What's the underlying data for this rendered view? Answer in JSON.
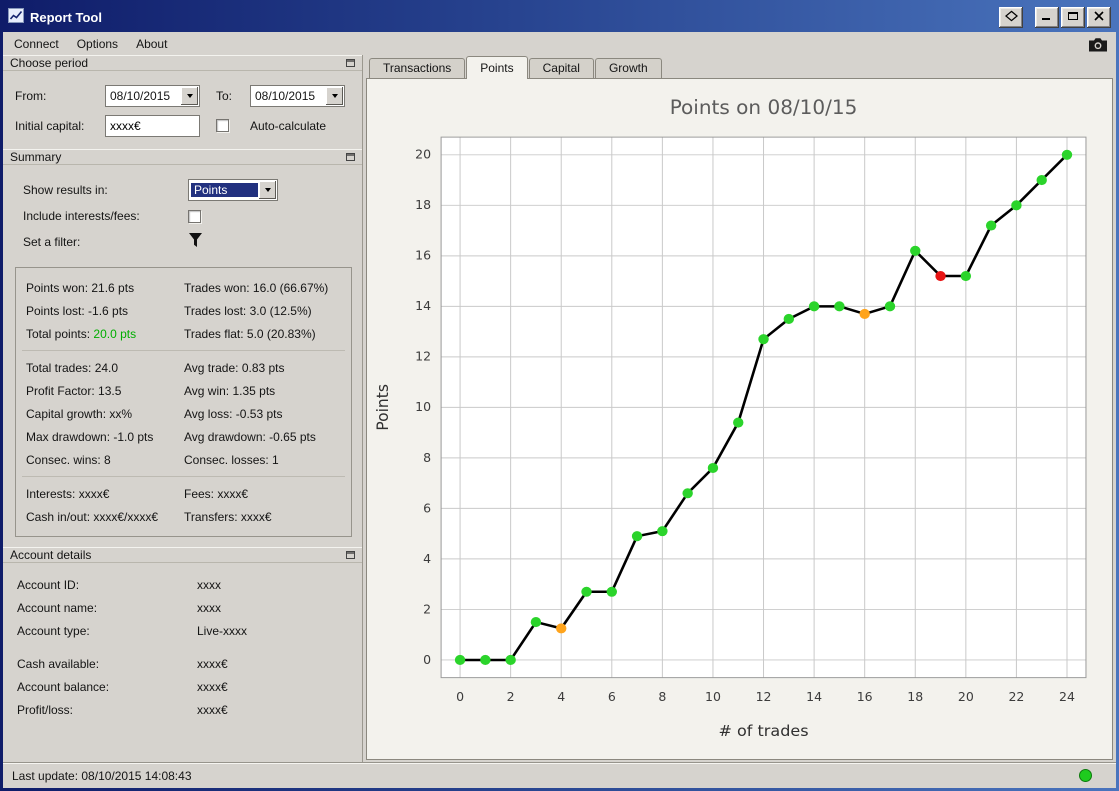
{
  "window": {
    "title": "Report Tool"
  },
  "menu": {
    "items": [
      "Connect",
      "Options",
      "About"
    ]
  },
  "choose_period": {
    "title": "Choose period",
    "from_label": "From:",
    "from_value": "08/10/2015",
    "to_label": "To:",
    "to_value": "08/10/2015",
    "initial_capital_label": "Initial capital:",
    "initial_capital_value": "xxxx€",
    "auto_calculate_label": "Auto-calculate"
  },
  "summary": {
    "title": "Summary",
    "show_results_label": "Show results in:",
    "show_results_value": "Points",
    "include_interests_label": "Include interests/fees:",
    "filter_label": "Set a filter:",
    "stats": {
      "points_won": "Points won: 21.6 pts",
      "trades_won": "Trades won: 16.0 (66.67%)",
      "points_lost": "Points lost: -1.6 pts",
      "trades_lost": "Trades lost: 3.0 (12.5%)",
      "total_points_label": "Total points:",
      "total_points_value": "20.0 pts",
      "trades_flat": "Trades flat: 5.0 (20.83%)",
      "total_trades": "Total trades: 24.0",
      "avg_trade": "Avg trade: 0.83 pts",
      "profit_factor": "Profit Factor: 13.5",
      "avg_win": "Avg win: 1.35 pts",
      "capital_growth": "Capital growth: xx%",
      "avg_loss": "Avg loss: -0.53 pts",
      "max_drawdown": "Max drawdown: -1.0 pts",
      "avg_drawdown": "Avg drawdown: -0.65 pts",
      "consec_wins": "Consec. wins: 8",
      "consec_losses": "Consec. losses: 1",
      "interests": "Interests: xxxx€",
      "fees": "Fees: xxxx€",
      "cash_in_out": "Cash in/out: xxxx€/xxxx€",
      "transfers": "Transfers: xxxx€"
    }
  },
  "account": {
    "title": "Account details",
    "rows": [
      {
        "label": "Account ID:",
        "value": "xxxx"
      },
      {
        "label": "Account name:",
        "value": "xxxx"
      },
      {
        "label": "Account type:",
        "value": "Live-xxxx"
      },
      {
        "label": "Cash available:",
        "value": "xxxx€"
      },
      {
        "label": "Account balance:",
        "value": "xxxx€"
      },
      {
        "label": "Profit/loss:",
        "value": "xxxx€"
      }
    ]
  },
  "tabs": {
    "items": [
      "Transactions",
      "Points",
      "Capital",
      "Growth"
    ],
    "active": "Points"
  },
  "status": {
    "last_update": "Last update: 08/10/2015 14:08:43"
  },
  "colors": {
    "positive_text": "#00ae00",
    "status_ok": "#1ecb1e",
    "selection_bg": "#22317f",
    "selection_text": "#ffffff"
  },
  "icons": {
    "app_icon": "mini-line-chart",
    "detach_button": "diamond-outline",
    "minimize_button": "underscore",
    "maximize_button": "square",
    "close_button": "x",
    "camera": "screenshot-camera",
    "float_panel": "small-window",
    "dropdown": "triangle-down",
    "filter": "funnel",
    "status_indicator": "green-circle"
  },
  "chart_data": {
    "type": "line",
    "title": "Points on 08/10/15",
    "xlabel": "# of trades",
    "ylabel": "Points",
    "x": [
      0,
      1,
      2,
      3,
      4,
      5,
      6,
      7,
      8,
      9,
      10,
      11,
      12,
      13,
      14,
      15,
      16,
      17,
      18,
      19,
      20,
      21,
      22,
      23,
      24
    ],
    "y": [
      0,
      0,
      0,
      1.5,
      1.25,
      2.7,
      2.7,
      4.9,
      5.1,
      6.6,
      7.6,
      9.4,
      12.7,
      13.5,
      14.0,
      14.0,
      13.7,
      14.0,
      16.2,
      15.2,
      15.2,
      17.2,
      18.0,
      19.0,
      20.0
    ],
    "point_colors": [
      "#2bd42b",
      "#2bd42b",
      "#2bd42b",
      "#2bd42b",
      "#ffa41c",
      "#2bd42b",
      "#2bd42b",
      "#2bd42b",
      "#2bd42b",
      "#2bd42b",
      "#2bd42b",
      "#2bd42b",
      "#2bd42b",
      "#2bd42b",
      "#2bd42b",
      "#2bd42b",
      "#ffa41c",
      "#2bd42b",
      "#2bd42b",
      "#e81414",
      "#2bd42b",
      "#2bd42b",
      "#2bd42b",
      "#2bd42b",
      "#2bd42b"
    ],
    "xlim": [
      -0.75,
      24.75
    ],
    "ylim": [
      -0.7,
      20.7
    ],
    "xticks": [
      0,
      2,
      4,
      6,
      8,
      10,
      12,
      14,
      16,
      18,
      20,
      22,
      24
    ],
    "yticks": [
      0,
      2,
      4,
      6,
      8,
      10,
      12,
      14,
      16,
      18,
      20
    ],
    "grid": true,
    "line_color": "#000000",
    "plot_bg": "#ffffff",
    "grid_color": "#c9c9c9",
    "frame_color": "#9a9a9a",
    "title_color": "#5c5c5c",
    "tick_color": "#3c3c3c",
    "label_color": "#303030"
  }
}
